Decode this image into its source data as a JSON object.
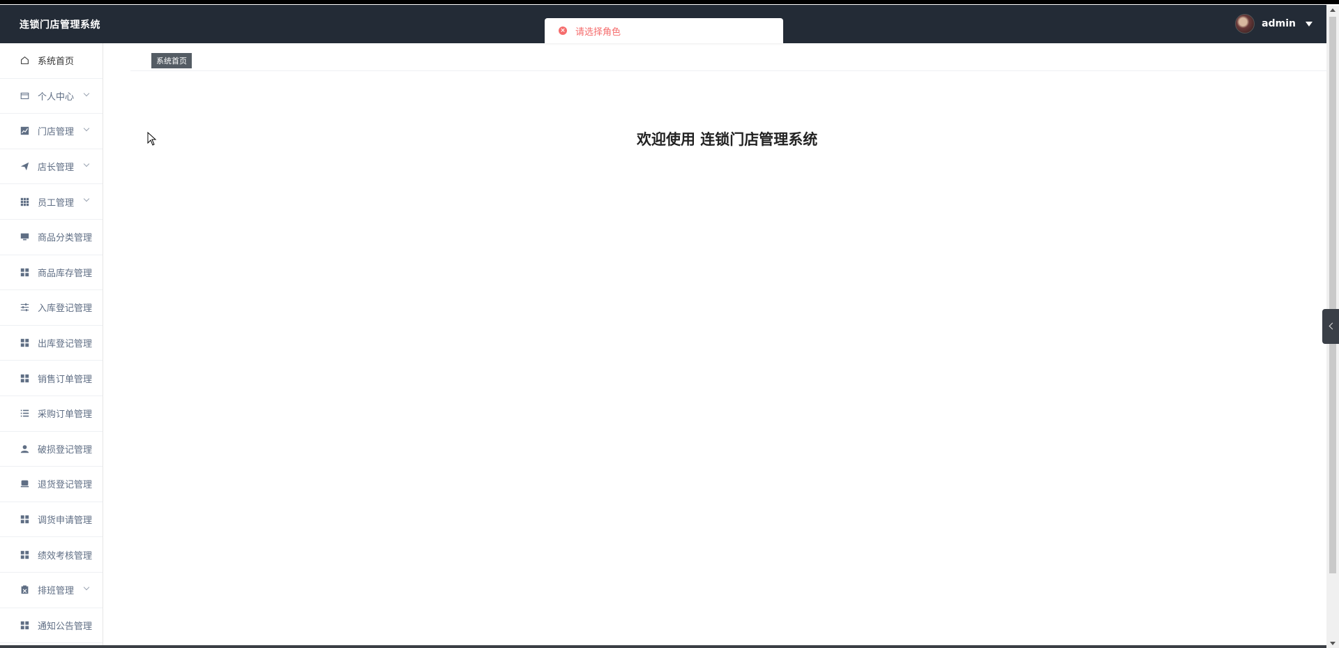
{
  "navbar": {
    "brand": "连锁门店管理系统",
    "username": "admin"
  },
  "toast": {
    "message": "请选择角色"
  },
  "sidebar": {
    "items": [
      {
        "label": "系统首页",
        "icon": "home-icon",
        "has_submenu": false
      },
      {
        "label": "个人中心",
        "icon": "wallet-icon",
        "has_submenu": true
      },
      {
        "label": "门店管理",
        "icon": "chart-icon",
        "has_submenu": true
      },
      {
        "label": "店长管理",
        "icon": "send-icon",
        "has_submenu": true
      },
      {
        "label": "员工管理",
        "icon": "grid-icon",
        "has_submenu": true
      },
      {
        "label": "商品分类管理",
        "icon": "monitor-icon",
        "has_submenu": false
      },
      {
        "label": "商品库存管理",
        "icon": "apps-icon",
        "has_submenu": false
      },
      {
        "label": "入库登记管理",
        "icon": "sliders-icon",
        "has_submenu": false
      },
      {
        "label": "出库登记管理",
        "icon": "apps-icon",
        "has_submenu": false
      },
      {
        "label": "销售订单管理",
        "icon": "apps-icon",
        "has_submenu": false
      },
      {
        "label": "采购订单管理",
        "icon": "list-icon",
        "has_submenu": false
      },
      {
        "label": "破损登记管理",
        "icon": "user-icon",
        "has_submenu": false
      },
      {
        "label": "退货登记管理",
        "icon": "box-icon",
        "has_submenu": false
      },
      {
        "label": "调货申请管理",
        "icon": "apps-icon",
        "has_submenu": false
      },
      {
        "label": "绩效考核管理",
        "icon": "apps-icon",
        "has_submenu": false
      },
      {
        "label": "排班管理",
        "icon": "clipboard-icon",
        "has_submenu": true
      },
      {
        "label": "通知公告管理",
        "icon": "apps-icon",
        "has_submenu": false
      }
    ]
  },
  "breadcrumb": {
    "current": "系统首页"
  },
  "main": {
    "welcome": "欢迎使用 连锁门店管理系统"
  }
}
